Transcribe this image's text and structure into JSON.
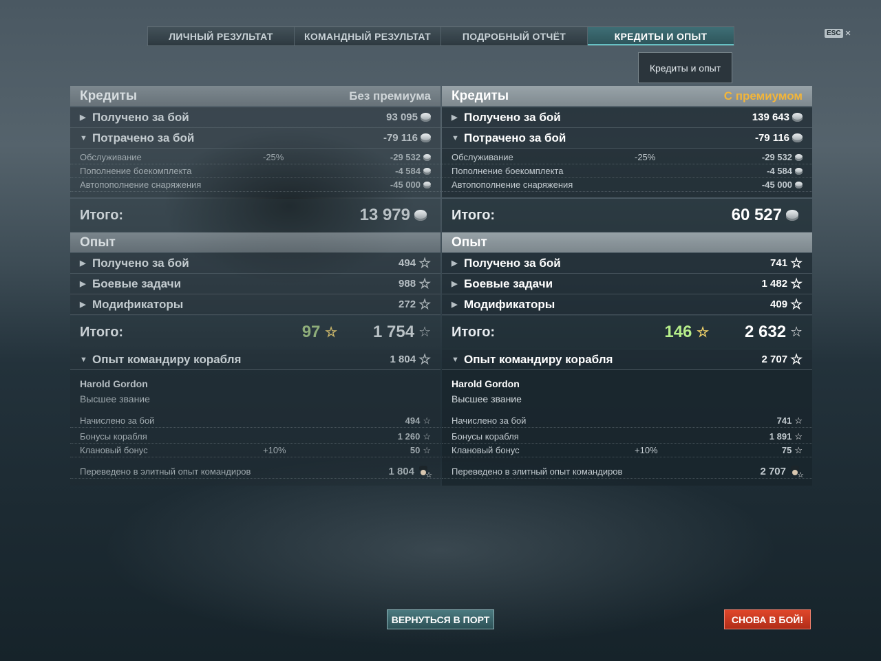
{
  "tabs": [
    {
      "label": "ЛИЧНЫЙ РЕЗУЛЬТАТ"
    },
    {
      "label": "КОМАНДНЫЙ РЕЗУЛЬТАТ"
    },
    {
      "label": "ПОДРОБНЫЙ ОТЧЁТ"
    },
    {
      "label": "КРЕДИТЫ И ОПЫТ"
    }
  ],
  "active_tab_index": 3,
  "esc_label": "ESC",
  "close_label": "×",
  "tooltip": "Кредиты и опыт",
  "left": {
    "credits_header": "Кредиты",
    "premium_tag": "Без премиума",
    "earned_label": "Получено за бой",
    "earned": "93 095",
    "spent_label": "Потрачено за бой",
    "spent": "-79 116",
    "maintenance_label": "Обслуживание",
    "maintenance_pct": "-25%",
    "maintenance": "-29 532",
    "ammo_label": "Пополнение боекомплекта",
    "ammo": "-4 584",
    "consumables_label": "Автопополнение снаряжения",
    "consumables": "-45 000",
    "credits_total_label": "Итого:",
    "credits_total": "13 979",
    "xp_header": "Опыт",
    "xp_earned_label": "Получено за бой",
    "xp_earned": "494",
    "missions_label": "Боевые задачи",
    "missions": "988",
    "modifiers_label": "Модификаторы",
    "modifiers": "272",
    "xp_total_label": "Итого:",
    "free_xp": "97",
    "xp_total": "1 754",
    "commander_label": "Опыт командиру корабля",
    "commander_xp": "1 804",
    "commander_name": "Harold Gordon",
    "commander_rank": "Высшее звание",
    "accrued_label": "Начислено за бой",
    "accrued": "494",
    "ship_bonus_label": "Бонусы корабля",
    "ship_bonus": "1 260",
    "clan_bonus_label": "Клановый бонус",
    "clan_bonus_pct": "+10%",
    "clan_bonus": "50",
    "elite_label": "Переведено в элитный опыт командиров",
    "elite": "1 804"
  },
  "right": {
    "credits_header": "Кредиты",
    "premium_tag": "С премиумом",
    "earned_label": "Получено за бой",
    "earned": "139 643",
    "spent_label": "Потрачено за бой",
    "spent": "-79 116",
    "maintenance_label": "Обслуживание",
    "maintenance_pct": "-25%",
    "maintenance": "-29 532",
    "ammo_label": "Пополнение боекомплекта",
    "ammo": "-4 584",
    "consumables_label": "Автопополнение снаряжения",
    "consumables": "-45 000",
    "credits_total_label": "Итого:",
    "credits_total": "60 527",
    "xp_header": "Опыт",
    "xp_earned_label": "Получено за бой",
    "xp_earned": "741",
    "missions_label": "Боевые задачи",
    "missions": "1 482",
    "modifiers_label": "Модификаторы",
    "modifiers": "409",
    "xp_total_label": "Итого:",
    "free_xp": "146",
    "xp_total": "2 632",
    "commander_label": "Опыт командиру корабля",
    "commander_xp": "2 707",
    "commander_name": "Harold Gordon",
    "commander_rank": "Высшее звание",
    "accrued_label": "Начислено за бой",
    "accrued": "741",
    "ship_bonus_label": "Бонусы корабля",
    "ship_bonus": "1 891",
    "clan_bonus_label": "Клановый бонус",
    "clan_bonus_pct": "+10%",
    "clan_bonus": "75",
    "elite_label": "Переведено в элитный опыт командиров",
    "elite": "2 707"
  },
  "buttons": {
    "return_port": "ВЕРНУТЬСЯ В ПОРТ",
    "battle_again": "СНОВА В БОЙ!"
  },
  "colors": {
    "premium_accent": "#f2b53a",
    "free_xp_premium": "#b6ee8a",
    "battle_button": "#d2391f",
    "port_button": "#3c676c"
  }
}
